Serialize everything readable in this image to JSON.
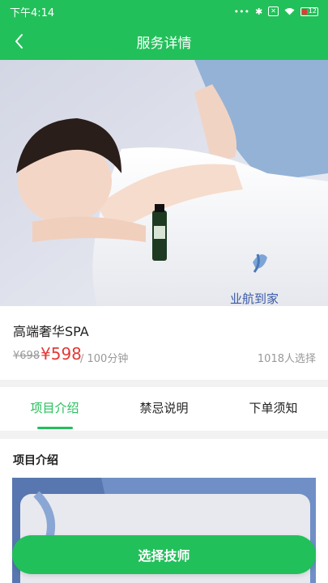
{
  "status_bar": {
    "time": "下午4:14",
    "battery": "12",
    "icons": [
      "more-dots-icon",
      "bluetooth-icon",
      "sim-off-icon",
      "wifi-icon",
      "battery-icon"
    ]
  },
  "nav": {
    "title": "服务详情"
  },
  "hero": {
    "watermark": "业航到家"
  },
  "service": {
    "name": "高端奢华SPA",
    "original_price": "¥698",
    "price": "¥598",
    "duration": "/ 100分钟",
    "sold": "1018人选择"
  },
  "tabs": [
    {
      "label": "项目介绍",
      "active": true
    },
    {
      "label": "禁忌说明",
      "active": false
    },
    {
      "label": "下单须知",
      "active": false
    }
  ],
  "content": {
    "section_title": "项目介绍"
  },
  "cta": {
    "label": "选择技师"
  },
  "colors": {
    "brand": "#22c05a",
    "price": "#e53935"
  }
}
